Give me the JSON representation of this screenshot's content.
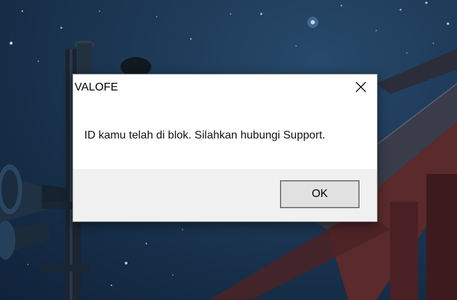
{
  "dialog": {
    "title": "VALOFE",
    "message": "ID kamu telah di blok. Silahkan hubungi Support.",
    "ok_label": "OK",
    "close_icon": "close-icon"
  },
  "background": {
    "description_icon": "night-sky-wallpaper"
  },
  "colors": {
    "sky": "#1e3a58",
    "dialog_bg": "#ffffff",
    "footer_bg": "#f0f0f0",
    "button_bg": "#e1e1e1"
  }
}
